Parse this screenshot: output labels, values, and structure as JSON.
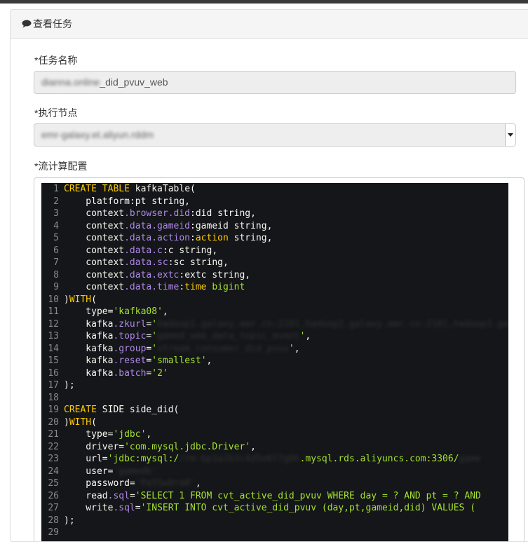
{
  "panel": {
    "title": "查看任务"
  },
  "form": {
    "task_name": {
      "label": "*任务名称",
      "value_obscured": "dianna.online",
      "value_suffix": "_did_pvuv_web"
    },
    "exec_node": {
      "label": "*执行节点",
      "value_obscured": "emr-galaxy.et.aliyun.rddm"
    },
    "stream_config": {
      "label": "*流计算配置"
    }
  },
  "code": {
    "lines": [
      {
        "n": "1",
        "t": [
          {
            "c": "k",
            "v": "CREATE TABLE"
          },
          {
            "c": "src",
            "v": " kafkaTable("
          }
        ]
      },
      {
        "n": "2",
        "t": [
          {
            "c": "src",
            "v": "    platform:pt string,"
          }
        ]
      },
      {
        "n": "3",
        "t": [
          {
            "c": "src",
            "v": "    context"
          },
          {
            "c": "p",
            "v": ".browser.did"
          },
          {
            "c": "src",
            "v": ":did string,"
          }
        ]
      },
      {
        "n": "4",
        "t": [
          {
            "c": "src",
            "v": "    context"
          },
          {
            "c": "p",
            "v": ".data.gameid"
          },
          {
            "c": "src",
            "v": ":gameid string,"
          }
        ]
      },
      {
        "n": "5",
        "t": [
          {
            "c": "src",
            "v": "    context"
          },
          {
            "c": "p",
            "v": ".data.action"
          },
          {
            "c": "src",
            "v": ":"
          },
          {
            "c": "k",
            "v": "action"
          },
          {
            "c": "src",
            "v": " string,"
          }
        ]
      },
      {
        "n": "6",
        "t": [
          {
            "c": "src",
            "v": "    context"
          },
          {
            "c": "p",
            "v": ".data.c"
          },
          {
            "c": "src",
            "v": ":c string,"
          }
        ]
      },
      {
        "n": "7",
        "t": [
          {
            "c": "src",
            "v": "    context"
          },
          {
            "c": "p",
            "v": ".data.sc"
          },
          {
            "c": "src",
            "v": ":sc string,"
          }
        ]
      },
      {
        "n": "8",
        "t": [
          {
            "c": "src",
            "v": "    context"
          },
          {
            "c": "p",
            "v": ".data.extc"
          },
          {
            "c": "src",
            "v": ":extc string,"
          }
        ]
      },
      {
        "n": "9",
        "t": [
          {
            "c": "src",
            "v": "    context"
          },
          {
            "c": "p",
            "v": ".data.time"
          },
          {
            "c": "src",
            "v": ":"
          },
          {
            "c": "k",
            "v": "time"
          },
          {
            "c": "src",
            "v": " "
          },
          {
            "c": "s",
            "v": "bigint"
          }
        ]
      },
      {
        "n": "10",
        "t": [
          {
            "c": "src",
            "v": ")"
          },
          {
            "c": "k",
            "v": "WITH"
          },
          {
            "c": "src",
            "v": "("
          }
        ]
      },
      {
        "n": "11",
        "t": [
          {
            "c": "src",
            "v": "    type="
          },
          {
            "c": "s",
            "v": "'kafka08'"
          },
          {
            "c": "src",
            "v": ","
          }
        ]
      },
      {
        "n": "12",
        "t": [
          {
            "c": "src",
            "v": "    kafka"
          },
          {
            "c": "p",
            "v": ".zkurl"
          },
          {
            "c": "src",
            "v": "="
          },
          {
            "c": "s",
            "v": "'"
          },
          {
            "c": "bl",
            "v": "hadoop1.galaxy.emr.cn:2181,hadoop2.galaxy.emr.cn:2181,hadoop3.gal"
          }
        ]
      },
      {
        "n": "13",
        "t": [
          {
            "c": "src",
            "v": "    kafka"
          },
          {
            "c": "p",
            "v": ".topic"
          },
          {
            "c": "src",
            "v": "="
          },
          {
            "c": "s",
            "v": "'"
          },
          {
            "c": "bl",
            "v": "gamed_web_data_topic_event"
          },
          {
            "c": "s",
            "v": "'"
          },
          {
            "c": "src",
            "v": ","
          }
        ]
      },
      {
        "n": "14",
        "t": [
          {
            "c": "src",
            "v": "    kafka"
          },
          {
            "c": "p",
            "v": ".group"
          },
          {
            "c": "src",
            "v": "="
          },
          {
            "c": "s",
            "v": "'"
          },
          {
            "c": "bl",
            "v": "stream_consumer_did_pvuv"
          },
          {
            "c": "s",
            "v": "'"
          },
          {
            "c": "src",
            "v": ","
          }
        ]
      },
      {
        "n": "15",
        "t": [
          {
            "c": "src",
            "v": "    kafka"
          },
          {
            "c": "p",
            "v": ".reset"
          },
          {
            "c": "src",
            "v": "="
          },
          {
            "c": "s",
            "v": "'smallest'"
          },
          {
            "c": "src",
            "v": ","
          }
        ]
      },
      {
        "n": "16",
        "t": [
          {
            "c": "src",
            "v": "    kafka"
          },
          {
            "c": "p",
            "v": ".batch"
          },
          {
            "c": "src",
            "v": "="
          },
          {
            "c": "s",
            "v": "'2'"
          }
        ]
      },
      {
        "n": "17",
        "t": [
          {
            "c": "src",
            "v": ");"
          }
        ]
      },
      {
        "n": "18",
        "t": [
          {
            "c": "src",
            "v": ""
          }
        ]
      },
      {
        "n": "19",
        "t": [
          {
            "c": "k",
            "v": "CREATE"
          },
          {
            "c": "src",
            "v": " SIDE side_did("
          }
        ]
      },
      {
        "n": "20",
        "t": [
          {
            "c": "src",
            "v": ")"
          },
          {
            "c": "k",
            "v": "WITH"
          },
          {
            "c": "src",
            "v": "("
          }
        ]
      },
      {
        "n": "21",
        "t": [
          {
            "c": "src",
            "v": "    type="
          },
          {
            "c": "s",
            "v": "'jdbc'"
          },
          {
            "c": "src",
            "v": ","
          }
        ]
      },
      {
        "n": "22",
        "t": [
          {
            "c": "src",
            "v": "    driver="
          },
          {
            "c": "s",
            "v": "'com.mysql.jdbc.Driver'"
          },
          {
            "c": "src",
            "v": ","
          }
        ]
      },
      {
        "n": "23",
        "t": [
          {
            "c": "src",
            "v": "    url="
          },
          {
            "c": "s",
            "v": "'jdbc:mysql:/"
          },
          {
            "c": "bl",
            "v": "/rm-bp1a2b3c4d5e6f7g8h"
          },
          {
            "c": "s",
            "v": ".mysql.rds.aliyuncs.com:3306/"
          },
          {
            "c": "bl",
            "v": "game"
          }
        ]
      },
      {
        "n": "24",
        "t": [
          {
            "c": "src",
            "v": "    user="
          },
          {
            "c": "bl",
            "v": "'gamedb'"
          }
        ]
      },
      {
        "n": "25",
        "t": [
          {
            "c": "src",
            "v": "    password="
          },
          {
            "c": "bl",
            "v": "'Pa55w0rd#'"
          },
          {
            "c": "src",
            "v": ","
          }
        ]
      },
      {
        "n": "26",
        "t": [
          {
            "c": "src",
            "v": "    read"
          },
          {
            "c": "p",
            "v": ".sql"
          },
          {
            "c": "src",
            "v": "="
          },
          {
            "c": "s",
            "v": "'SELECT 1 FROM cvt_active_did_pvuv WHERE day = ? AND pt = ? AND"
          }
        ]
      },
      {
        "n": "27",
        "t": [
          {
            "c": "src",
            "v": "    write"
          },
          {
            "c": "p",
            "v": ".sql"
          },
          {
            "c": "src",
            "v": "="
          },
          {
            "c": "s",
            "v": "'INSERT INTO cvt_active_did_pvuv (day,pt,gameid,did) VALUES ("
          }
        ]
      },
      {
        "n": "28",
        "t": [
          {
            "c": "src",
            "v": ");"
          }
        ]
      },
      {
        "n": "29",
        "t": [
          {
            "c": "src",
            "v": ""
          }
        ]
      }
    ]
  }
}
